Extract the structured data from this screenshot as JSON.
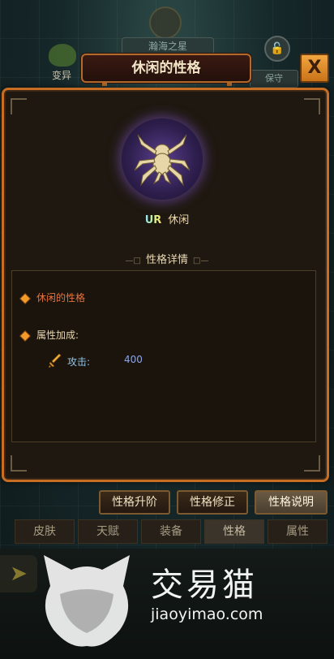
{
  "background": {
    "top_name": "瀚海之星",
    "mutate_label": "变异",
    "keep_label": "保守"
  },
  "modal": {
    "title": "休闲的性格",
    "close_label": "X",
    "rarity": "UR",
    "trait_name": "休闲",
    "section_title": "性格详情",
    "detail_name": "休闲的性格",
    "bonus_title": "属性加成:",
    "stats": [
      {
        "label": "攻击:",
        "value": "400"
      }
    ]
  },
  "sub_tabs": [
    "性格升阶",
    "性格修正",
    "性格说明"
  ],
  "active_sub_tab": "性格说明",
  "bottom_tabs": [
    "皮肤",
    "天赋",
    "装备",
    "性格",
    "属性"
  ],
  "active_bottom_tab": "性格",
  "watermark": {
    "brand_cn": "交易猫",
    "url": "jiaoyimao.com"
  },
  "colors": {
    "panel_border": "#c86e24",
    "close_button": "#f2a640",
    "detail_name": "#e9733c",
    "stat_value": "#8ea6e6"
  }
}
